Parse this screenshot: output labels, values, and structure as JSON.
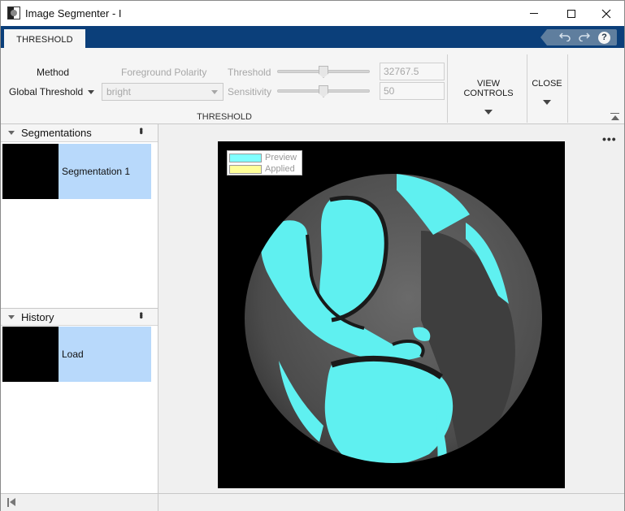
{
  "window": {
    "title": "Image Segmenter - I",
    "controls": {
      "minimize_icon": "minimize-icon",
      "maximize_icon": "maximize-icon",
      "close_icon": "close-icon"
    }
  },
  "ribbon": {
    "active_tab": "THRESHOLD",
    "quick_access": {
      "undo_icon": "undo-icon",
      "redo_icon": "redo-icon",
      "help_label": "?"
    },
    "threshold_group": {
      "method_label": "Method",
      "method_value": "Global Threshold",
      "polarity_label": "Foreground Polarity",
      "polarity_value": "bright",
      "threshold_label": "Threshold",
      "threshold_value": "32767.5",
      "threshold_slider_fraction": 0.5,
      "sensitivity_label": "Sensitivity",
      "sensitivity_value": "50",
      "sensitivity_slider_fraction": 0.5,
      "group_label": "THRESHOLD"
    },
    "view_controls_label": "VIEW CONTROLS",
    "close_label": "CLOSE"
  },
  "segmentations_panel": {
    "title": "Segmentations",
    "items": [
      {
        "label": "Segmentation 1"
      }
    ]
  },
  "history_panel": {
    "title": "History",
    "items": [
      {
        "label": "Load"
      }
    ]
  },
  "viewer": {
    "legend": [
      {
        "label": "Preview",
        "color": "#80ffff"
      },
      {
        "label": "Applied",
        "color": "#ffff99"
      }
    ],
    "overlay_color": "#5ff0f0"
  },
  "colors": {
    "tab_strip": "#0b3f7a",
    "selection": "#b8d9fb"
  }
}
